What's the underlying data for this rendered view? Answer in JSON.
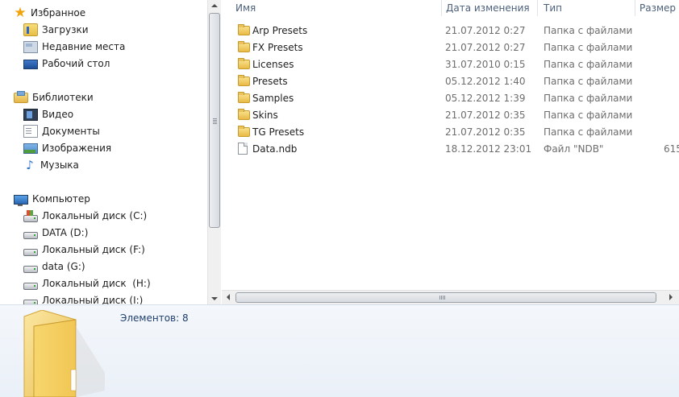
{
  "nav": {
    "favorites": {
      "header": "Избранное",
      "items": [
        {
          "label": "Загрузки",
          "icon": "downloads-folder-icon"
        },
        {
          "label": "Недавние места",
          "icon": "recent-places-icon"
        },
        {
          "label": "Рабочий стол",
          "icon": "desktop-icon"
        }
      ]
    },
    "libraries": {
      "header": "Библиотеки",
      "items": [
        {
          "label": "Видео",
          "icon": "video-icon"
        },
        {
          "label": "Документы",
          "icon": "documents-icon"
        },
        {
          "label": "Изображения",
          "icon": "images-icon"
        },
        {
          "label": "Музыка",
          "icon": "music-icon"
        }
      ]
    },
    "computer": {
      "header": "Компьютер",
      "items": [
        {
          "label": "Локальный диск (C:)",
          "icon": "system-drive-icon"
        },
        {
          "label": "DATA (D:)",
          "icon": "drive-icon"
        },
        {
          "label": "Локальный диск (F:)",
          "icon": "drive-icon"
        },
        {
          "label": "data (G:)",
          "icon": "drive-icon"
        },
        {
          "label": "Локальный диск  (H:)",
          "icon": "drive-icon"
        },
        {
          "label": "Локальный диск (I:)",
          "icon": "drive-icon"
        }
      ]
    }
  },
  "columns": {
    "name": "Имя",
    "date": "Дата изменения",
    "type": "Тип",
    "size": "Размер"
  },
  "files": [
    {
      "name": "Arp Presets",
      "date": "21.07.2012 0:27",
      "type": "Папка с файлами",
      "size": "",
      "kind": "folder"
    },
    {
      "name": "FX Presets",
      "date": "21.07.2012 0:27",
      "type": "Папка с файлами",
      "size": "",
      "kind": "folder"
    },
    {
      "name": "Licenses",
      "date": "31.07.2010 0:15",
      "type": "Папка с файлами",
      "size": "",
      "kind": "folder"
    },
    {
      "name": "Presets",
      "date": "05.12.2012 1:40",
      "type": "Папка с файлами",
      "size": "",
      "kind": "folder"
    },
    {
      "name": "Samples",
      "date": "05.12.2012 1:39",
      "type": "Папка с файлами",
      "size": "",
      "kind": "folder"
    },
    {
      "name": "Skins",
      "date": "21.07.2012 0:35",
      "type": "Папка с файлами",
      "size": "",
      "kind": "folder"
    },
    {
      "name": "TG Presets",
      "date": "21.07.2012 0:35",
      "type": "Папка с файлами",
      "size": "",
      "kind": "folder"
    },
    {
      "name": "Data.ndb",
      "date": "18.12.2012 23:01",
      "type": "Файл \"NDB\"",
      "size": "615",
      "kind": "file"
    }
  ],
  "details": {
    "item_count": "Элементов: 8"
  },
  "colors": {
    "folder": "#f0c95a",
    "header_text": "#4c607a",
    "details_bg": "#eef3fa"
  }
}
